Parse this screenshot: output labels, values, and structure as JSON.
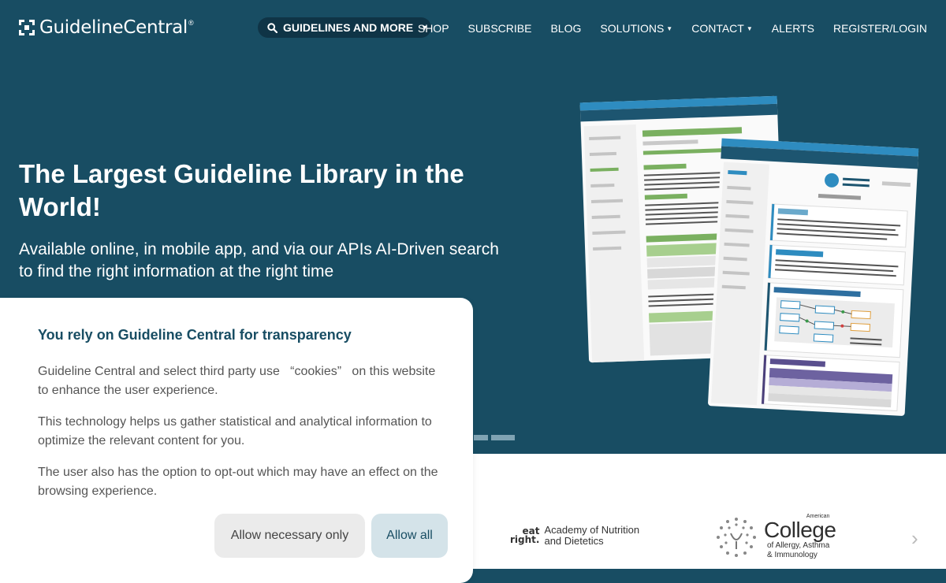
{
  "header": {
    "logo_text": "GuidelineCentral",
    "logo_reg": "®",
    "search_label": "GUIDELINES AND MORE",
    "nav": [
      {
        "label": "SHOP",
        "dropdown": false
      },
      {
        "label": "SUBSCRIBE",
        "dropdown": false
      },
      {
        "label": "BLOG",
        "dropdown": false
      },
      {
        "label": "SOLUTIONS",
        "dropdown": true
      },
      {
        "label": "CONTACT",
        "dropdown": true
      },
      {
        "label": "ALERTS",
        "dropdown": false
      },
      {
        "label": "REGISTER/LOGIN",
        "dropdown": false
      }
    ]
  },
  "hero": {
    "title": "The Largest Guideline Library in the World!",
    "subtitle": "Available online, in mobile app, and via our APIs AI-Driven search to find the right information at the right time"
  },
  "partners": {
    "eatright_mark_1": "eat",
    "eatright_mark_2": "right.",
    "eatright_line1": "Academy of Nutrition",
    "eatright_line2": "and Dietetics",
    "acaai_small": "American",
    "acaai_big": "College",
    "acaai_line1": "of Allergy, Asthma",
    "acaai_line2": "& Immunology"
  },
  "cookie": {
    "title": "You rely on Guideline Central for transparency",
    "p1": "Guideline Central and select third party use   “cookies”   on this website to enhance the user experience.",
    "p2": "This technology helps us gather statistical and analytical information to optimize the relevant content for you.",
    "p3": "The user also has the option to opt-out which may have an effect on the browsing experience.",
    "btn_necessary": "Allow necessary only",
    "btn_all": "Allow all"
  },
  "colors": {
    "hero_bg": "#184d63",
    "search_pill": "#0f3446",
    "accent_title": "#184d63",
    "btn_all_bg": "#d4e3e9"
  }
}
